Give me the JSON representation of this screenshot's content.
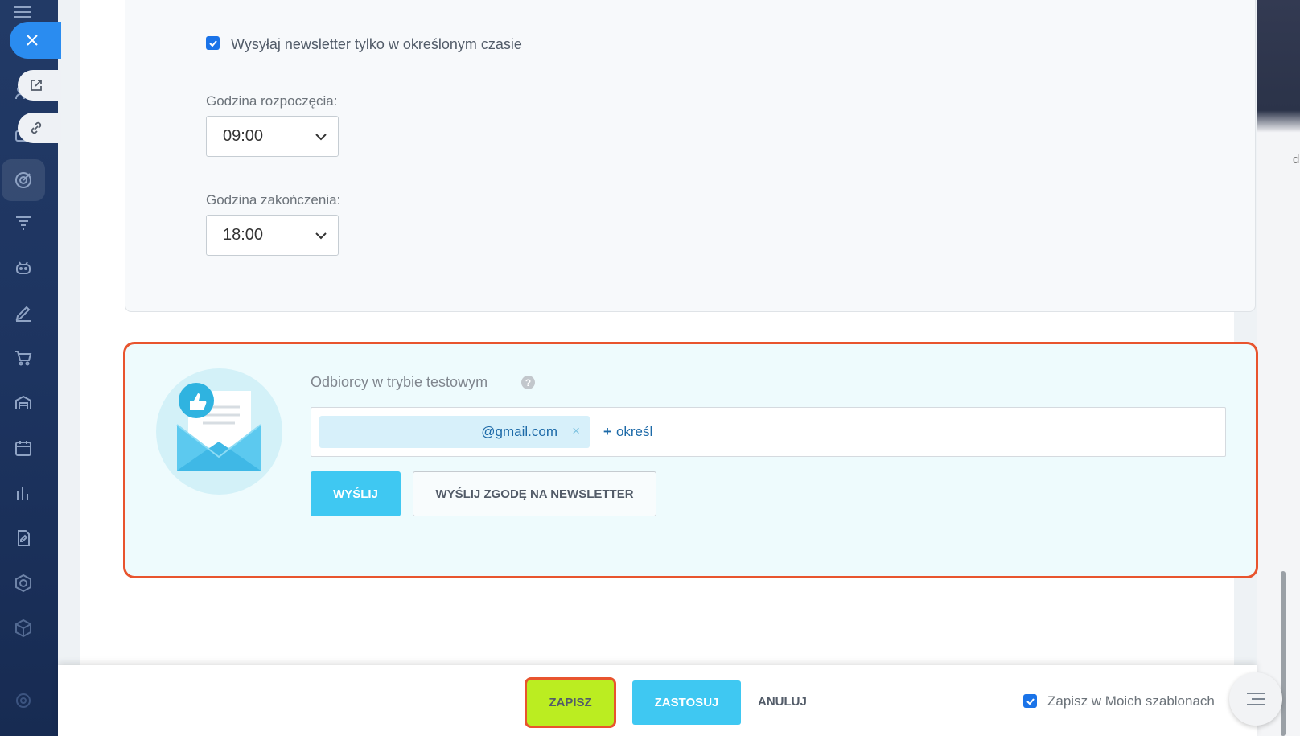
{
  "window": {
    "close_icon": "close-icon"
  },
  "left_tools": {
    "open_icon": "external-link-icon",
    "link_icon": "link-icon"
  },
  "sidebar": {
    "icons": [
      "menu-icon",
      "target-icon",
      "funnel-icon",
      "robot-icon",
      "pen-icon",
      "cart-icon",
      "warehouse-icon",
      "calendar-icon",
      "chart-icon",
      "document-edit-icon",
      "hexagon-icon",
      "cube-icon",
      "gear-icon"
    ]
  },
  "schedule": {
    "send_in_time_checked": true,
    "send_in_time_label": "Wysyłaj newsletter tylko w określonym czasie",
    "start_label": "Godzina rozpoczęcia:",
    "start_value": "09:00",
    "end_label": "Godzina zakończenia:",
    "end_value": "18:00"
  },
  "test_mode": {
    "title": "Odbiorcy w trybie testowym",
    "help": "?",
    "email_chip": "@gmail.com",
    "chip_remove": "×",
    "add_plus": "+",
    "add_label": "określ",
    "send_button": "WYŚLIJ",
    "consent_button": "WYŚLIJ ZGODĘ NA NEWSLETTER"
  },
  "footer": {
    "save": "ZAPISZ",
    "apply": "ZASTOSUJ",
    "cancel": "ANULUJ",
    "save_template_checked": true,
    "save_template_label": "Zapisz w Moich szablonach"
  },
  "backdrop": {
    "edge_letter": "d"
  },
  "colors": {
    "accent_blue": "#3fc8f2",
    "save_green": "#bbed21",
    "highlight_red": "#e8542e",
    "checkbox_blue": "#1a73e8"
  }
}
